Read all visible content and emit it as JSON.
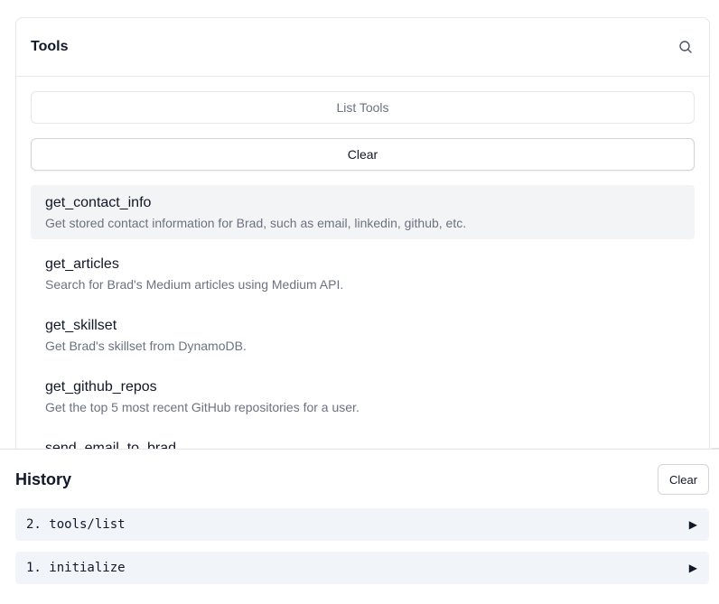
{
  "tools": {
    "title": "Tools",
    "list_tools_label": "List Tools",
    "clear_label": "Clear",
    "items": [
      {
        "name": "get_contact_info",
        "description": "Get stored contact information for Brad, such as email, linkedin, github, etc.",
        "selected": true
      },
      {
        "name": "get_articles",
        "description": "Search for Brad's Medium articles using Medium API."
      },
      {
        "name": "get_skillset",
        "description": "Get Brad's skillset from DynamoDB."
      },
      {
        "name": "get_github_repos",
        "description": "Get the top 5 most recent GitHub repositories for a user."
      },
      {
        "name": "send_email_to_brad",
        "description": ""
      }
    ],
    "search_icon": "search-icon"
  },
  "history": {
    "title": "History",
    "clear_label": "Clear",
    "items": [
      {
        "label": "2. tools/list",
        "expand_icon": "▶"
      },
      {
        "label": "1. initialize",
        "expand_icon": "▶"
      }
    ]
  },
  "colors": {
    "border": "#e5e7eb",
    "selected_bg": "#f3f4f6",
    "history_item_bg": "#f1f5f9",
    "muted_text": "#6b7280"
  }
}
